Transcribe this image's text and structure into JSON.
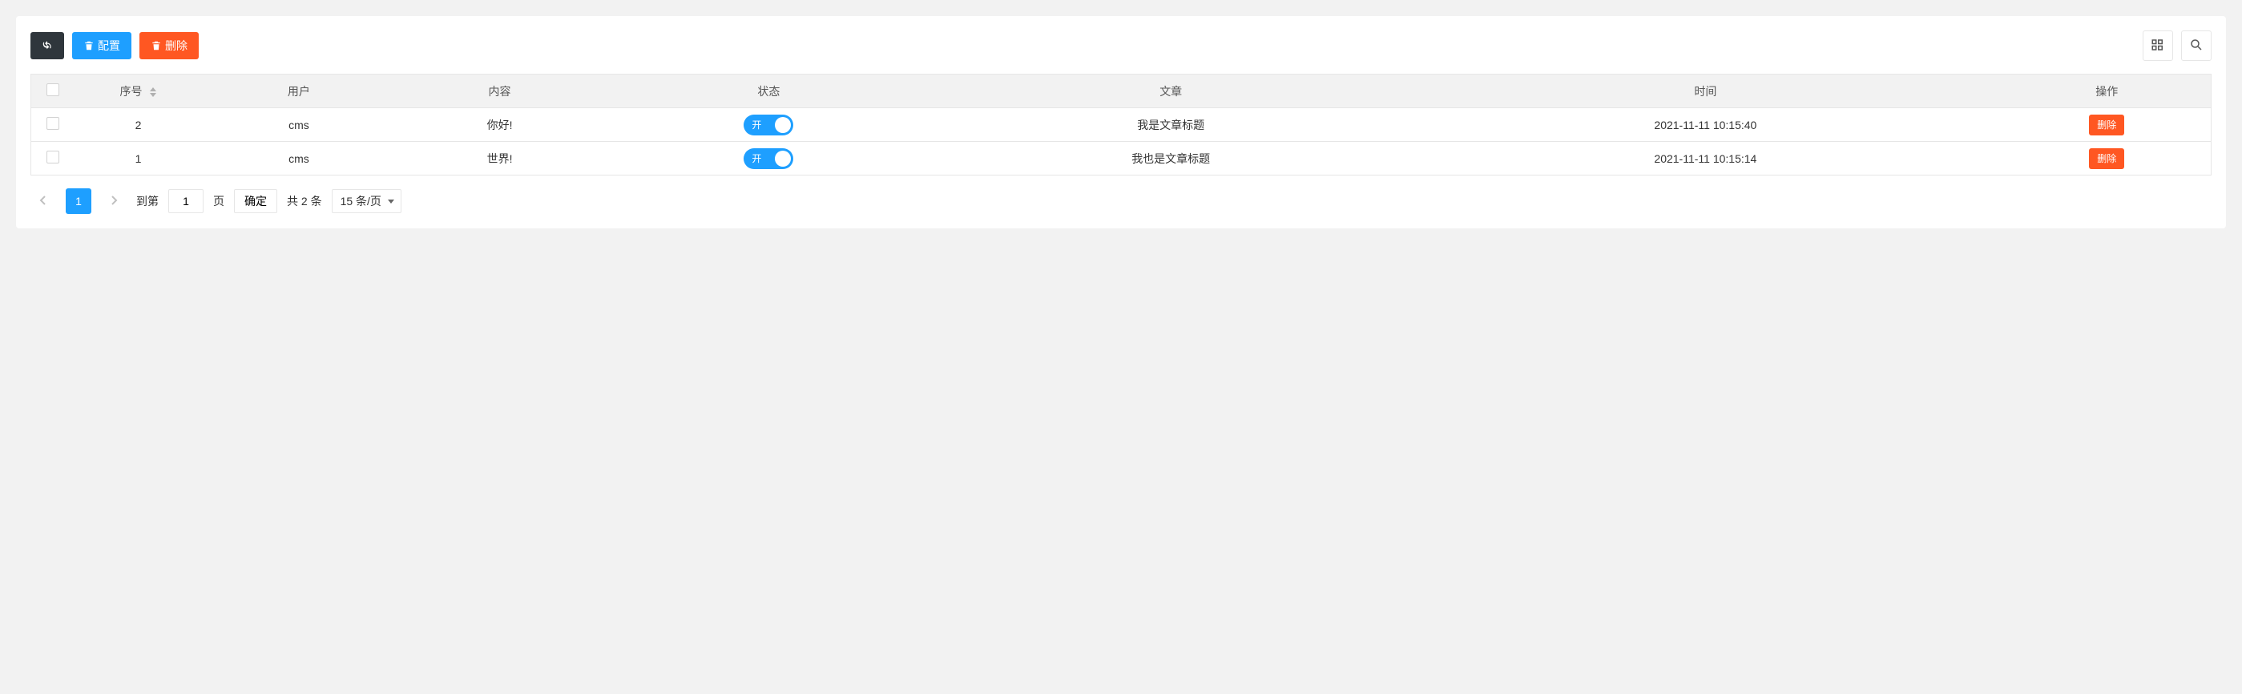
{
  "toolbar": {
    "config_label": "配置",
    "delete_label": "删除"
  },
  "columns": {
    "seq": "序号",
    "user": "用户",
    "content": "内容",
    "status": "状态",
    "article": "文章",
    "time": "时间",
    "op": "操作"
  },
  "rows": [
    {
      "seq": "2",
      "user": "cms",
      "content": "你好!",
      "status_label": "开",
      "status_on": true,
      "article": "我是文章标题",
      "time": "2021-11-11 10:15:40",
      "op_delete": "删除"
    },
    {
      "seq": "1",
      "user": "cms",
      "content": "世界!",
      "status_label": "开",
      "status_on": true,
      "article": "我也是文章标题",
      "time": "2021-11-11 10:15:14",
      "op_delete": "删除"
    }
  ],
  "pagination": {
    "current": "1",
    "goto_prefix": "到第",
    "goto_value": "1",
    "goto_suffix": "页",
    "confirm": "确定",
    "total": "共 2 条",
    "page_size": "15 条/页"
  }
}
